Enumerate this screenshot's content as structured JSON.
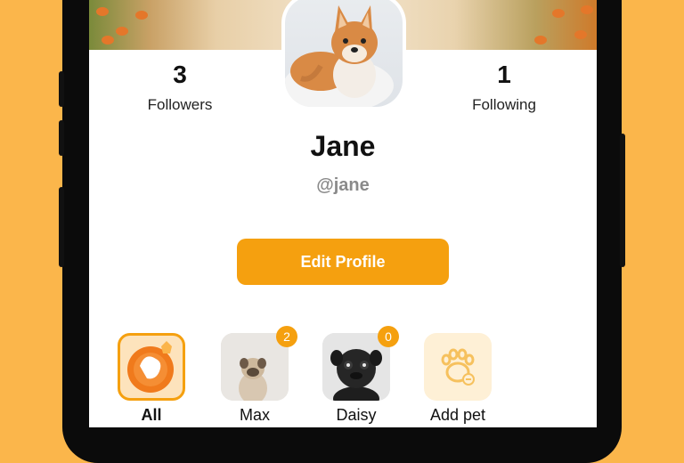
{
  "profile": {
    "followers_count": "3",
    "followers_label": "Followers",
    "following_count": "1",
    "following_label": "Following",
    "name": "Jane",
    "handle": "@jane",
    "edit_button": "Edit Profile"
  },
  "pets": [
    {
      "label": "All",
      "selected": true
    },
    {
      "label": "Max",
      "badge": "2"
    },
    {
      "label": "Daisy",
      "badge": "0"
    },
    {
      "label": "Add pet"
    }
  ],
  "colors": {
    "background": "#FBB64B",
    "accent": "#F5A00F",
    "handle_gray": "#8a8a8a"
  }
}
